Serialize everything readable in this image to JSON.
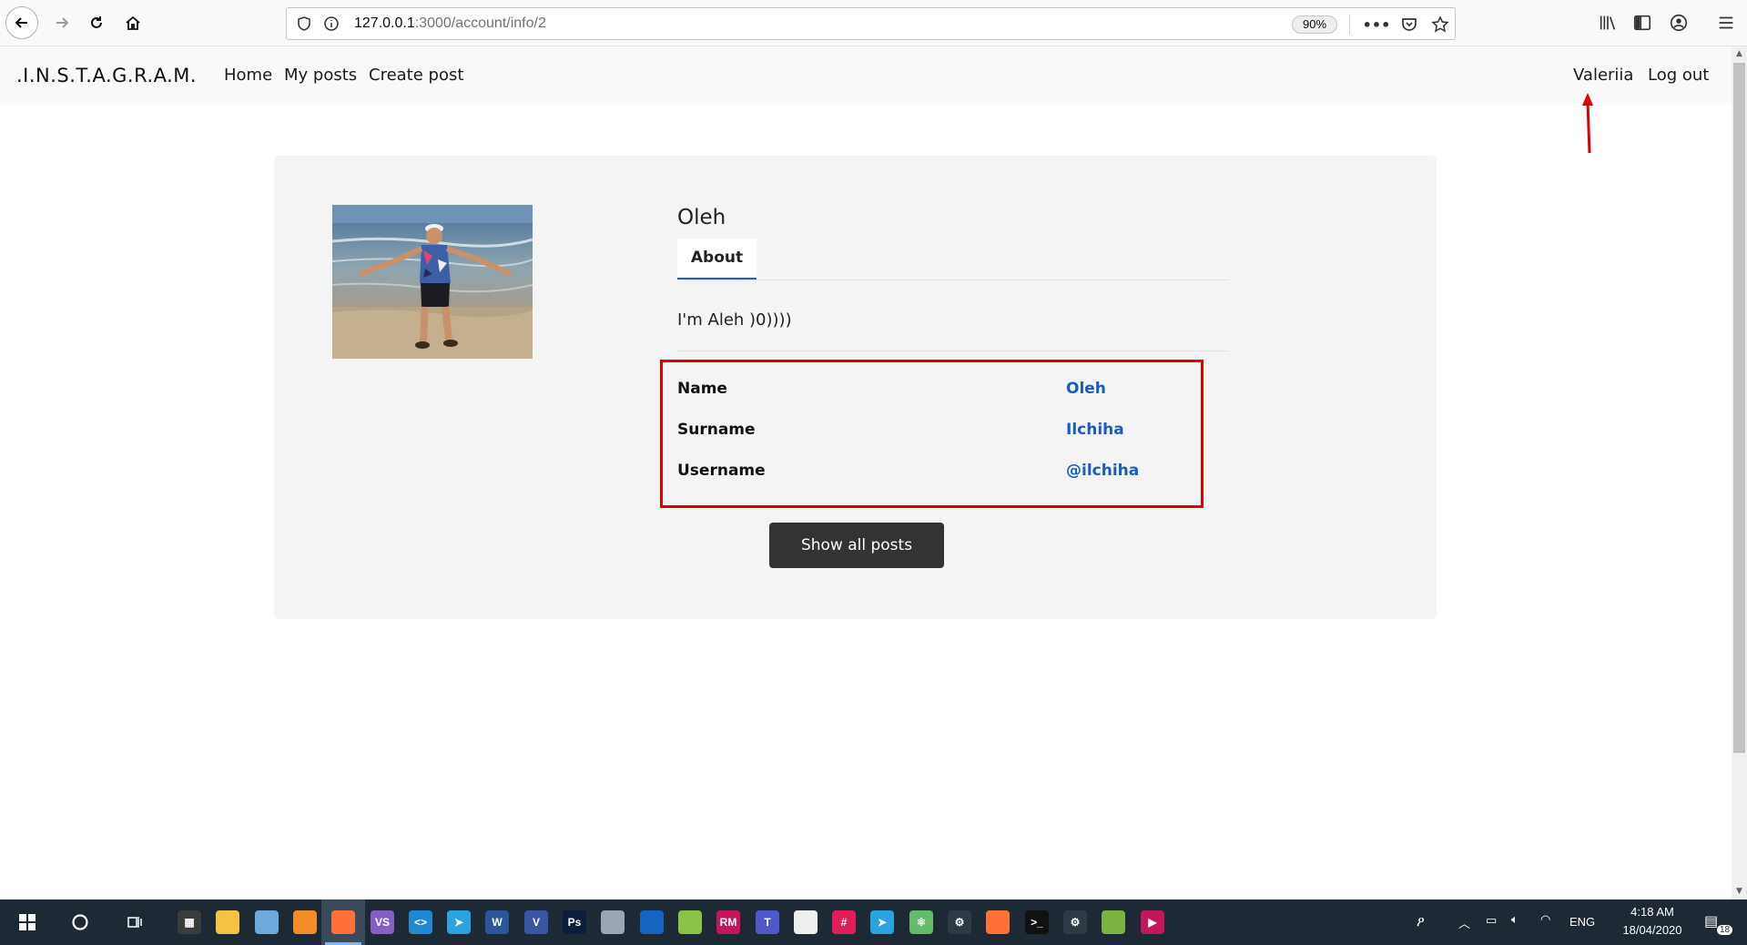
{
  "browser": {
    "url_host": "127.0.0.1",
    "url_path": ":3000/account/info/2",
    "zoom": "90%",
    "more_label": "•••"
  },
  "navbar": {
    "brand": ".I.N.S.T.A.G.R.A.M.",
    "links": [
      "Home",
      "My posts",
      "Create post"
    ],
    "user": "Valeriia",
    "logout": "Log out"
  },
  "profile": {
    "name": "Oleh",
    "tab_label": "About",
    "bio": "I'm Aleh )0))))",
    "fields": [
      {
        "label": "Name",
        "value": "Oleh"
      },
      {
        "label": "Surname",
        "value": "Ilchiha"
      },
      {
        "label": "Username",
        "value": "@ilchiha"
      }
    ],
    "show_posts": "Show all posts"
  },
  "taskbar": {
    "apps": [
      {
        "name": "calculator",
        "color": "#3b3b3b",
        "text": "▦"
      },
      {
        "name": "file-explorer",
        "color": "#f5c342",
        "text": ""
      },
      {
        "name": "notepad",
        "color": "#6fa8dc",
        "text": ""
      },
      {
        "name": "app-orange",
        "color": "#f28c28",
        "text": ""
      },
      {
        "name": "firefox",
        "color": "#ff7139",
        "text": ""
      },
      {
        "name": "visual-studio",
        "color": "#865fc5",
        "text": "VS"
      },
      {
        "name": "vscode",
        "color": "#1f8ad2",
        "text": "<>"
      },
      {
        "name": "telegram",
        "color": "#2aa3e0",
        "text": "➤"
      },
      {
        "name": "word",
        "color": "#2b579a",
        "text": "W"
      },
      {
        "name": "visio",
        "color": "#3955a3",
        "text": "V"
      },
      {
        "name": "photoshop",
        "color": "#0b1f3a",
        "text": "Ps"
      },
      {
        "name": "paint",
        "color": "#9aa7b1",
        "text": ""
      },
      {
        "name": "sharkfin",
        "color": "#1565c0",
        "text": ""
      },
      {
        "name": "maps",
        "color": "#8bc34a",
        "text": ""
      },
      {
        "name": "rubymine",
        "color": "#c2185b",
        "text": "RM"
      },
      {
        "name": "teams",
        "color": "#5059c9",
        "text": "T"
      },
      {
        "name": "gimp",
        "color": "#efefef",
        "text": ""
      },
      {
        "name": "slack",
        "color": "#e01e5a",
        "text": "#"
      },
      {
        "name": "telegram-2",
        "color": "#2aa3e0",
        "text": "➤"
      },
      {
        "name": "atom",
        "color": "#66bb6a",
        "text": "⚛"
      },
      {
        "name": "settings",
        "color": "#2d3a46",
        "text": "⚙"
      },
      {
        "name": "firefox-2",
        "color": "#ff7139",
        "text": ""
      },
      {
        "name": "terminal",
        "color": "#111111",
        "text": ">_"
      },
      {
        "name": "settings-2",
        "color": "#2d3a46",
        "text": "⚙"
      },
      {
        "name": "image-viewer",
        "color": "#7cb342",
        "text": ""
      },
      {
        "name": "media-player",
        "color": "#c2185b",
        "text": "▶"
      }
    ],
    "lang": "ENG",
    "time": "4:18 AM",
    "date": "18/04/2020",
    "notifications": "18"
  }
}
